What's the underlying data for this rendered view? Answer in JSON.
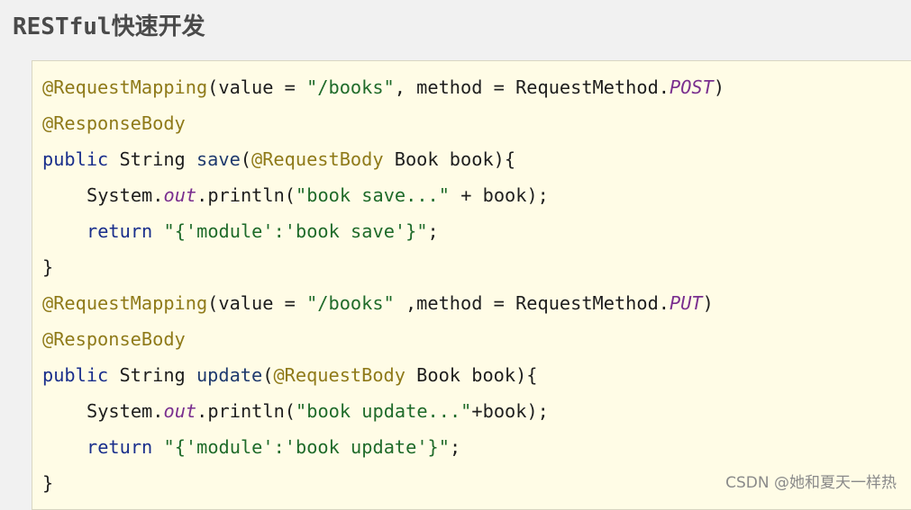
{
  "title": {
    "prefix": "RESTful",
    "suffix": "快速开发"
  },
  "code": {
    "line1": {
      "ann": "@RequestMapping",
      "mid": "(value = ",
      "str": "\"/books\"",
      "mid2": ", method = RequestMethod.",
      "field": "POST",
      "end": ")"
    },
    "line2": {
      "ann": "@ResponseBody"
    },
    "line3": {
      "kw": "public",
      "type": " String ",
      "fn": "save",
      "open": "(",
      "ann": "@RequestBody",
      "rest": " Book book){"
    },
    "line4": {
      "pre": "System.",
      "field": "out",
      "mid": ".println(",
      "str": "\"book save...\"",
      "rest": " + book);"
    },
    "line5": {
      "kw": "return",
      "space": " ",
      "str": "\"{'module':'book save'}\"",
      "rest": ";"
    },
    "line6": {
      "text": "}"
    },
    "line7": {
      "ann": "@RequestMapping",
      "mid": "(value = ",
      "str": "\"/books\"",
      "mid2": " ,method = RequestMethod.",
      "field": "PUT",
      "end": ")"
    },
    "line8": {
      "ann": "@ResponseBody"
    },
    "line9": {
      "kw": "public",
      "type": " String ",
      "fn": "update",
      "open": "(",
      "ann": "@RequestBody",
      "rest": " Book book){"
    },
    "line10": {
      "pre": "System.",
      "field": "out",
      "mid": ".println(",
      "str": "\"book update...\"",
      "rest": "+book);"
    },
    "line11": {
      "kw": "return",
      "space": " ",
      "str": "\"{'module':'book update'}\"",
      "rest": ";"
    },
    "line12": {
      "text": "}"
    }
  },
  "watermark": "CSDN @她和夏天一样热",
  "colors": {
    "annotation": "#8f7a19",
    "keyword": "#1a2f8c",
    "string": "#1f6b2a",
    "static_field": "#7a2f8f",
    "panel_background": "#fffce6"
  }
}
